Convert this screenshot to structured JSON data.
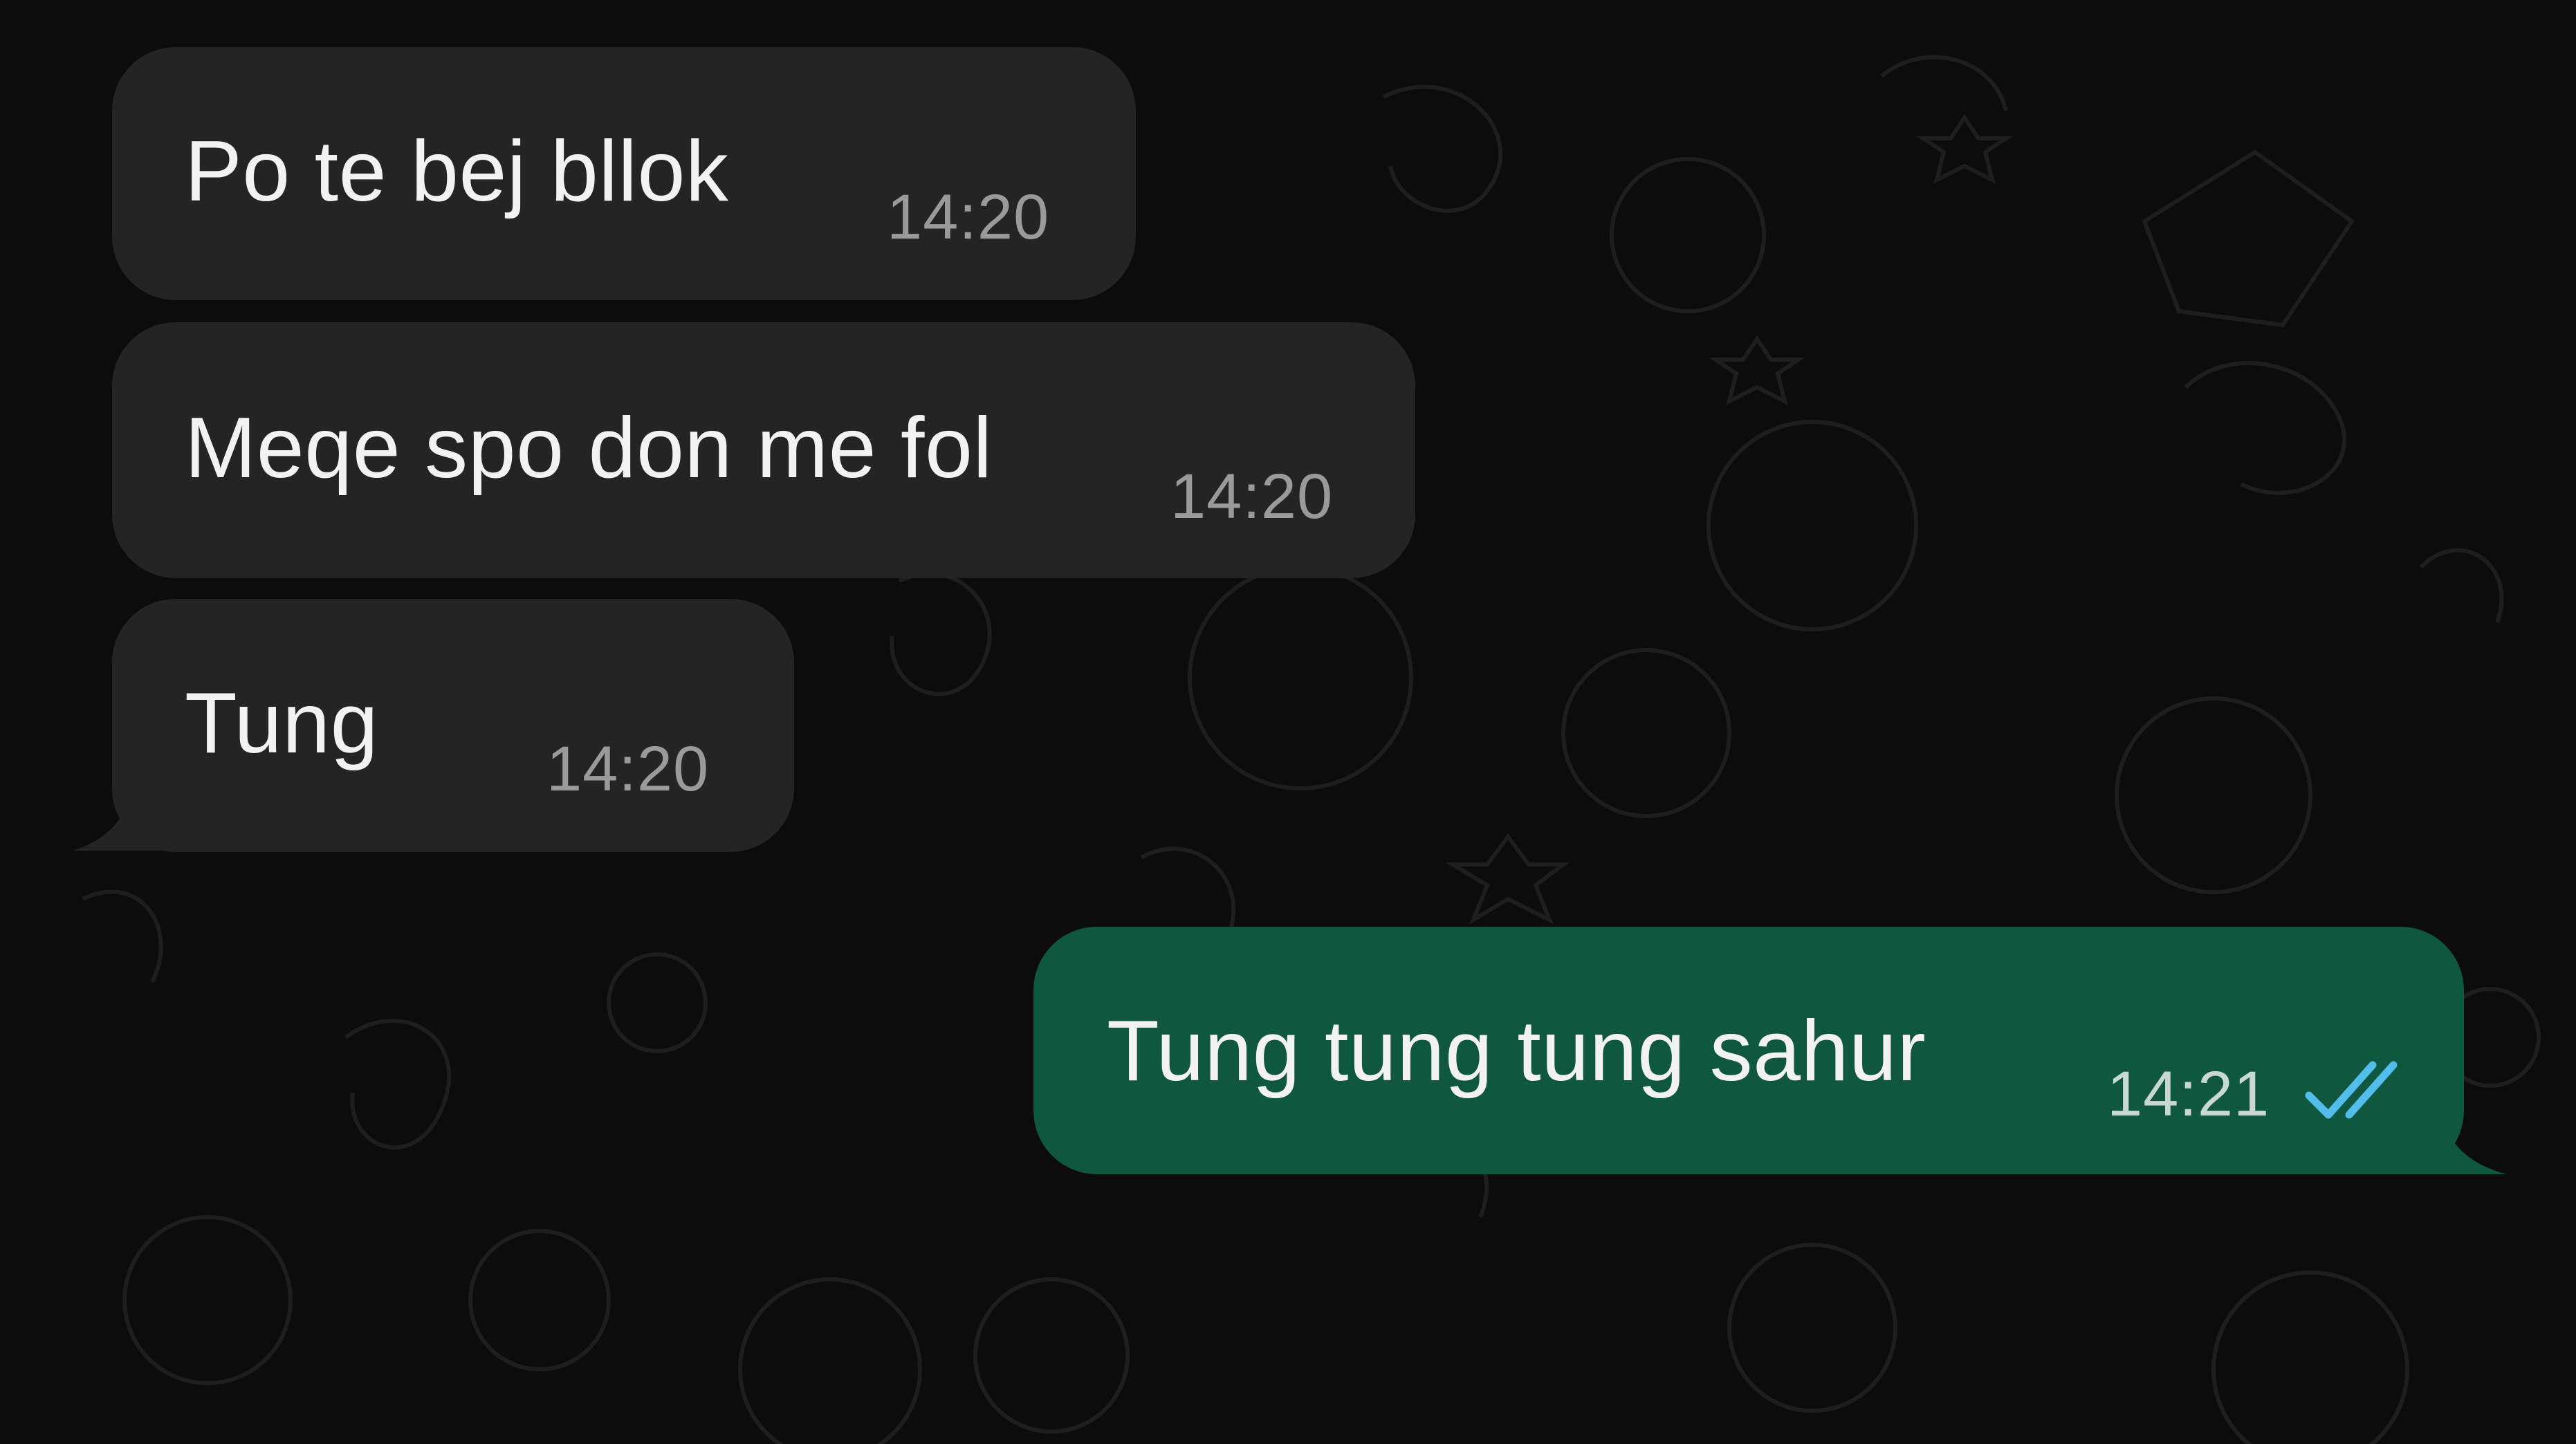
{
  "theme": {
    "background": "#0c0c0c",
    "incoming_bubble": "#242424",
    "outgoing_bubble": "#10573f",
    "text": "#f2f2f2",
    "time": "#9a9a9a",
    "read_receipt": "#53bdeb"
  },
  "messages": [
    {
      "direction": "incoming",
      "text": "Po te bej bllok",
      "time": "14:20"
    },
    {
      "direction": "incoming",
      "text": "Meqe spo don me fol",
      "time": "14:20"
    },
    {
      "direction": "incoming",
      "text": "Tung",
      "time": "14:20"
    },
    {
      "direction": "outgoing",
      "text": "Tung tung tung sahur",
      "time": "14:21",
      "status_icon": "double-check-read-icon"
    }
  ]
}
